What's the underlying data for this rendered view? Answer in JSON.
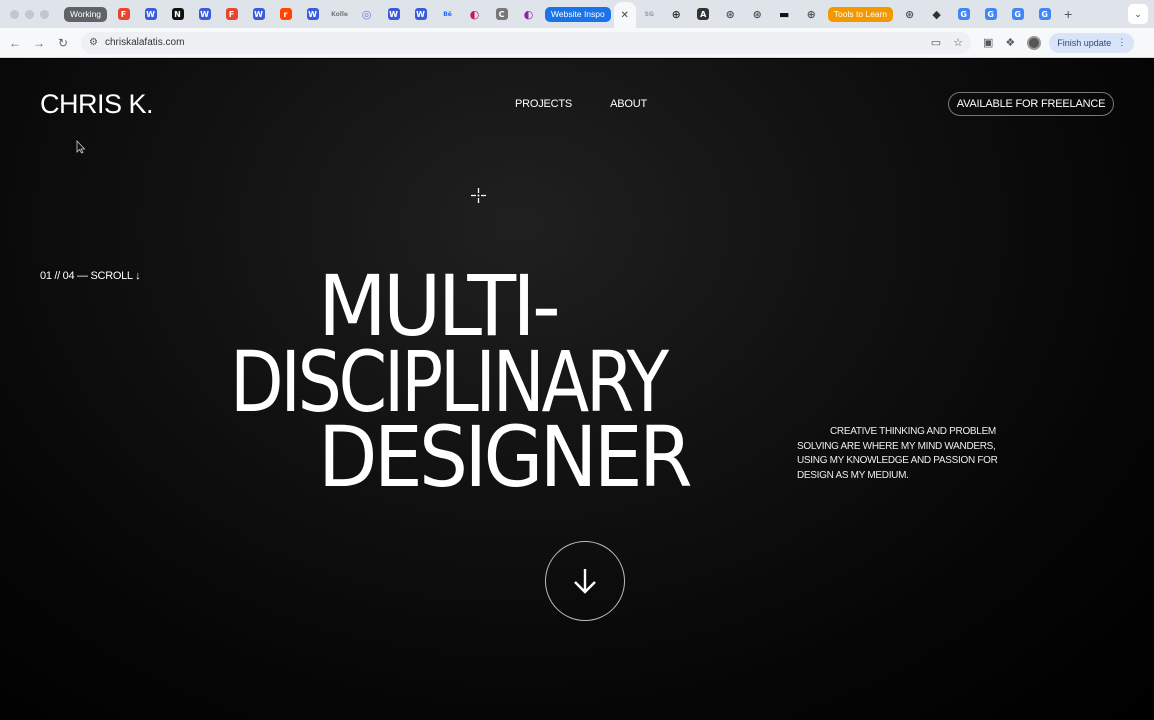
{
  "browser": {
    "tab_groups": [
      {
        "label": "Working",
        "color": "#5f6368"
      },
      {
        "label": "Website Inspo",
        "color": "#1a73e8"
      },
      {
        "label": "Tools to Learn",
        "color": "#f29900"
      }
    ],
    "favicons_before_working": [],
    "favicons_working": [
      {
        "glyph": "F",
        "color": "#e8442e"
      },
      {
        "glyph": "W",
        "color": "#3b5bdb"
      },
      {
        "glyph": "N",
        "color": "#111111"
      },
      {
        "glyph": "W",
        "color": "#3b5bdb"
      },
      {
        "glyph": "F",
        "color": "#e8442e"
      },
      {
        "glyph": "W",
        "color": "#3b5bdb"
      },
      {
        "glyph": "r",
        "color": "#ff4500"
      },
      {
        "glyph": "W",
        "color": "#3b5bdb"
      },
      {
        "glyph": "Kolle",
        "color": "#777777"
      },
      {
        "glyph": "◎",
        "color": "#6b7fd7"
      },
      {
        "glyph": "W",
        "color": "#3b5bdb"
      },
      {
        "glyph": "W",
        "color": "#3b5bdb"
      },
      {
        "glyph": "Bē",
        "color": "#1769ff"
      },
      {
        "glyph": "◐",
        "color": "#c2185b"
      },
      {
        "glyph": "C",
        "color": "#777777"
      },
      {
        "glyph": "◐",
        "color": "#8e24aa"
      }
    ],
    "favicons_inspo": [
      {
        "glyph": "SG",
        "color": "#999999"
      },
      {
        "glyph": "⊕",
        "color": "#333333"
      },
      {
        "glyph": "A",
        "color": "#333333"
      },
      {
        "glyph": "⊛",
        "color": "#555555"
      },
      {
        "glyph": "⊛",
        "color": "#555555"
      },
      {
        "glyph": "▬",
        "color": "#111111"
      },
      {
        "glyph": "⊕",
        "color": "#555555"
      }
    ],
    "favicons_tools": [
      {
        "glyph": "⊛",
        "color": "#555555"
      },
      {
        "glyph": "◆",
        "color": "#333333"
      },
      {
        "glyph": "G",
        "color": "#4285f4"
      },
      {
        "glyph": "G",
        "color": "#4285f4"
      },
      {
        "glyph": "G",
        "color": "#4285f4"
      },
      {
        "glyph": "G",
        "color": "#4285f4"
      }
    ],
    "active_tab_close": "✕",
    "new_tab": "+",
    "url": "chriskalafatis.com",
    "finish_update": "Finish update"
  },
  "site": {
    "logo": "CHRIS K.",
    "nav": [
      "PROJECTS",
      "ABOUT"
    ],
    "cta": "AVAILABLE FOR FREELANCE",
    "counter": "01 // 04 — SCROLL ↓",
    "hero": [
      "MULTI-",
      "DISCIPLINARY",
      "DESIGNER"
    ],
    "tagline": "CREATIVE THINKING AND PROBLEM SOLVING ARE WHERE MY MIND WANDERS, USING MY KNOWLEDGE AND PASSION FOR DESIGN AS MY MEDIUM.",
    "background": "#000000",
    "text_color": "#ffffff"
  }
}
